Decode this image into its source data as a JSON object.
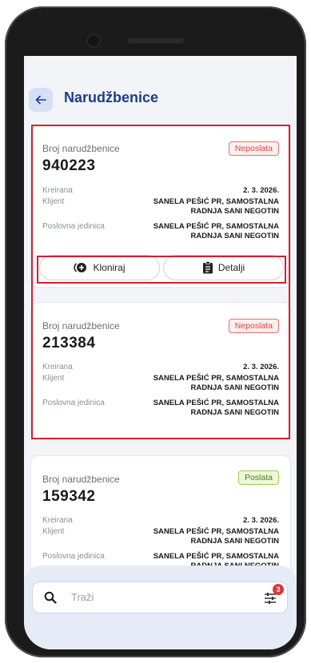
{
  "header": {
    "title": "Narudžbenice"
  },
  "labels": {
    "order_number": "Broj narudžbenice",
    "created": "Kreirana",
    "client": "Klijent",
    "business_unit": "Poslovna jedinica"
  },
  "orders": [
    {
      "number": "940223",
      "status": "Neposlata",
      "created": "2. 3. 2026.",
      "client": "SANELA PEŠIĆ PR, SAMOSTALNA RADNJA SANI NEGOTIN",
      "business_unit": "SANELA PEŠIĆ PR, SAMOSTALNA RADNJA SANI NEGOTIN"
    },
    {
      "number": "213384",
      "status": "Neposlata",
      "created": "2. 3. 2026.",
      "client": "SANELA PEŠIĆ PR, SAMOSTALNA RADNJA SANI NEGOTIN",
      "business_unit": "SANELA PEŠIĆ PR, SAMOSTALNA RADNJA SANI NEGOTIN"
    },
    {
      "number": "159342",
      "status": "Poslata",
      "created": "2. 3. 2026.",
      "client": "SANELA PEŠIĆ PR, SAMOSTALNA RADNJA SANI NEGOTIN",
      "business_unit": "SANELA PEŠIĆ PR, SAMOSTALNA RADNJA SANI NEGOTIN"
    }
  ],
  "actions": {
    "clone_label": "Kloniraj",
    "details_label": "Detalji"
  },
  "search": {
    "placeholder": "Traži",
    "filter_count": "3"
  },
  "colors": {
    "accent": "#1d3c8a",
    "highlight": "#d91c2e",
    "unsent": "#d84a4a",
    "sent": "#4e7d1f"
  }
}
